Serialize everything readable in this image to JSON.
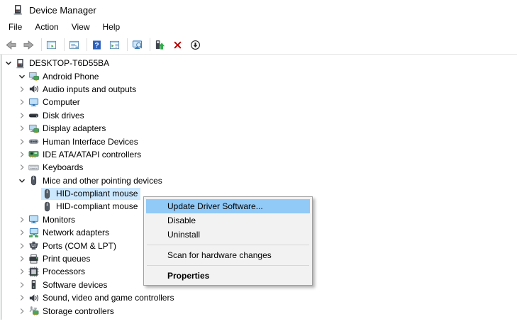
{
  "window": {
    "title": "Device Manager",
    "icon": "device-manager-icon"
  },
  "menu_bar": {
    "items": [
      {
        "label": "File"
      },
      {
        "label": "Action"
      },
      {
        "label": "View"
      },
      {
        "label": "Help"
      }
    ]
  },
  "toolbar": {
    "buttons": [
      {
        "name": "back",
        "icon": "back-icon"
      },
      {
        "name": "forward",
        "icon": "forward-icon"
      },
      {
        "separator": true
      },
      {
        "name": "show-console-tree",
        "icon": "console-tree-icon"
      },
      {
        "separator": true
      },
      {
        "name": "show-properties",
        "icon": "properties-window-icon"
      },
      {
        "separator": true
      },
      {
        "name": "help",
        "icon": "help-icon"
      },
      {
        "name": "show-action-pane",
        "icon": "action-pane-icon"
      },
      {
        "separator": true
      },
      {
        "name": "scan-for-hardware-changes",
        "icon": "scan-hardware-icon"
      },
      {
        "separator": true
      },
      {
        "name": "update-driver",
        "icon": "update-driver-icon"
      },
      {
        "name": "uninstall",
        "icon": "uninstall-icon"
      },
      {
        "name": "disable",
        "icon": "disable-icon"
      }
    ]
  },
  "tree": {
    "items": [
      {
        "label": "DESKTOP-T6D55BA",
        "level": 0,
        "chevron": "expanded",
        "icon": "computer-pc-icon",
        "selected": false
      },
      {
        "label": "Android Phone",
        "level": 1,
        "chevron": "expanded",
        "icon": "portable-device-icon",
        "selected": false
      },
      {
        "label": "Audio inputs and outputs",
        "level": 1,
        "chevron": "collapsed",
        "icon": "speaker-icon",
        "selected": false
      },
      {
        "label": "Computer",
        "level": 1,
        "chevron": "collapsed",
        "icon": "monitor-icon",
        "selected": false
      },
      {
        "label": "Disk drives",
        "level": 1,
        "chevron": "collapsed",
        "icon": "disk-drive-icon",
        "selected": false
      },
      {
        "label": "Display adapters",
        "level": 1,
        "chevron": "collapsed",
        "icon": "display-adapter-icon",
        "selected": false
      },
      {
        "label": "Human Interface Devices",
        "level": 1,
        "chevron": "collapsed",
        "icon": "gamepad-icon",
        "selected": false
      },
      {
        "label": "IDE ATA/ATAPI controllers",
        "level": 1,
        "chevron": "collapsed",
        "icon": "controller-card-icon",
        "selected": false
      },
      {
        "label": "Keyboards",
        "level": 1,
        "chevron": "collapsed",
        "icon": "keyboard-icon",
        "selected": false
      },
      {
        "label": "Mice and other pointing devices",
        "level": 1,
        "chevron": "expanded",
        "icon": "mouse-icon",
        "selected": false
      },
      {
        "label": "HID-compliant mouse",
        "level": 2,
        "chevron": "none",
        "icon": "mouse-icon",
        "selected": true
      },
      {
        "label": "HID-compliant mouse",
        "level": 2,
        "chevron": "none",
        "icon": "mouse-icon",
        "selected": false
      },
      {
        "label": "Monitors",
        "level": 1,
        "chevron": "collapsed",
        "icon": "monitor-icon",
        "selected": false
      },
      {
        "label": "Network adapters",
        "level": 1,
        "chevron": "collapsed",
        "icon": "network-adapter-icon",
        "selected": false
      },
      {
        "label": "Ports (COM & LPT)",
        "level": 1,
        "chevron": "collapsed",
        "icon": "serial-port-icon",
        "selected": false
      },
      {
        "label": "Print queues",
        "level": 1,
        "chevron": "collapsed",
        "icon": "printer-icon",
        "selected": false
      },
      {
        "label": "Processors",
        "level": 1,
        "chevron": "collapsed",
        "icon": "processor-icon",
        "selected": false
      },
      {
        "label": "Software devices",
        "level": 1,
        "chevron": "collapsed",
        "icon": "software-device-icon",
        "selected": false
      },
      {
        "label": "Sound, video and game controllers",
        "level": 1,
        "chevron": "collapsed",
        "icon": "speaker-icon",
        "selected": false
      },
      {
        "label": "Storage controllers",
        "level": 1,
        "chevron": "collapsed",
        "icon": "storage-controller-icon",
        "selected": false
      }
    ]
  },
  "context_menu": {
    "items": [
      {
        "name": "update-driver-software",
        "label": "Update Driver Software...",
        "highlighted": true
      },
      {
        "name": "disable-device",
        "label": "Disable"
      },
      {
        "name": "uninstall-device",
        "label": "Uninstall"
      },
      {
        "separator": true
      },
      {
        "name": "scan-hardware-changes",
        "label": "Scan for hardware changes"
      },
      {
        "separator": true
      },
      {
        "name": "properties",
        "label": "Properties",
        "bold": true
      }
    ]
  },
  "colors": {
    "tree_selection": "#cce8ff",
    "menu_highlight": "#91c9f7",
    "uninstall_red": "#c00000",
    "help_blue": "#2b5fbd"
  }
}
